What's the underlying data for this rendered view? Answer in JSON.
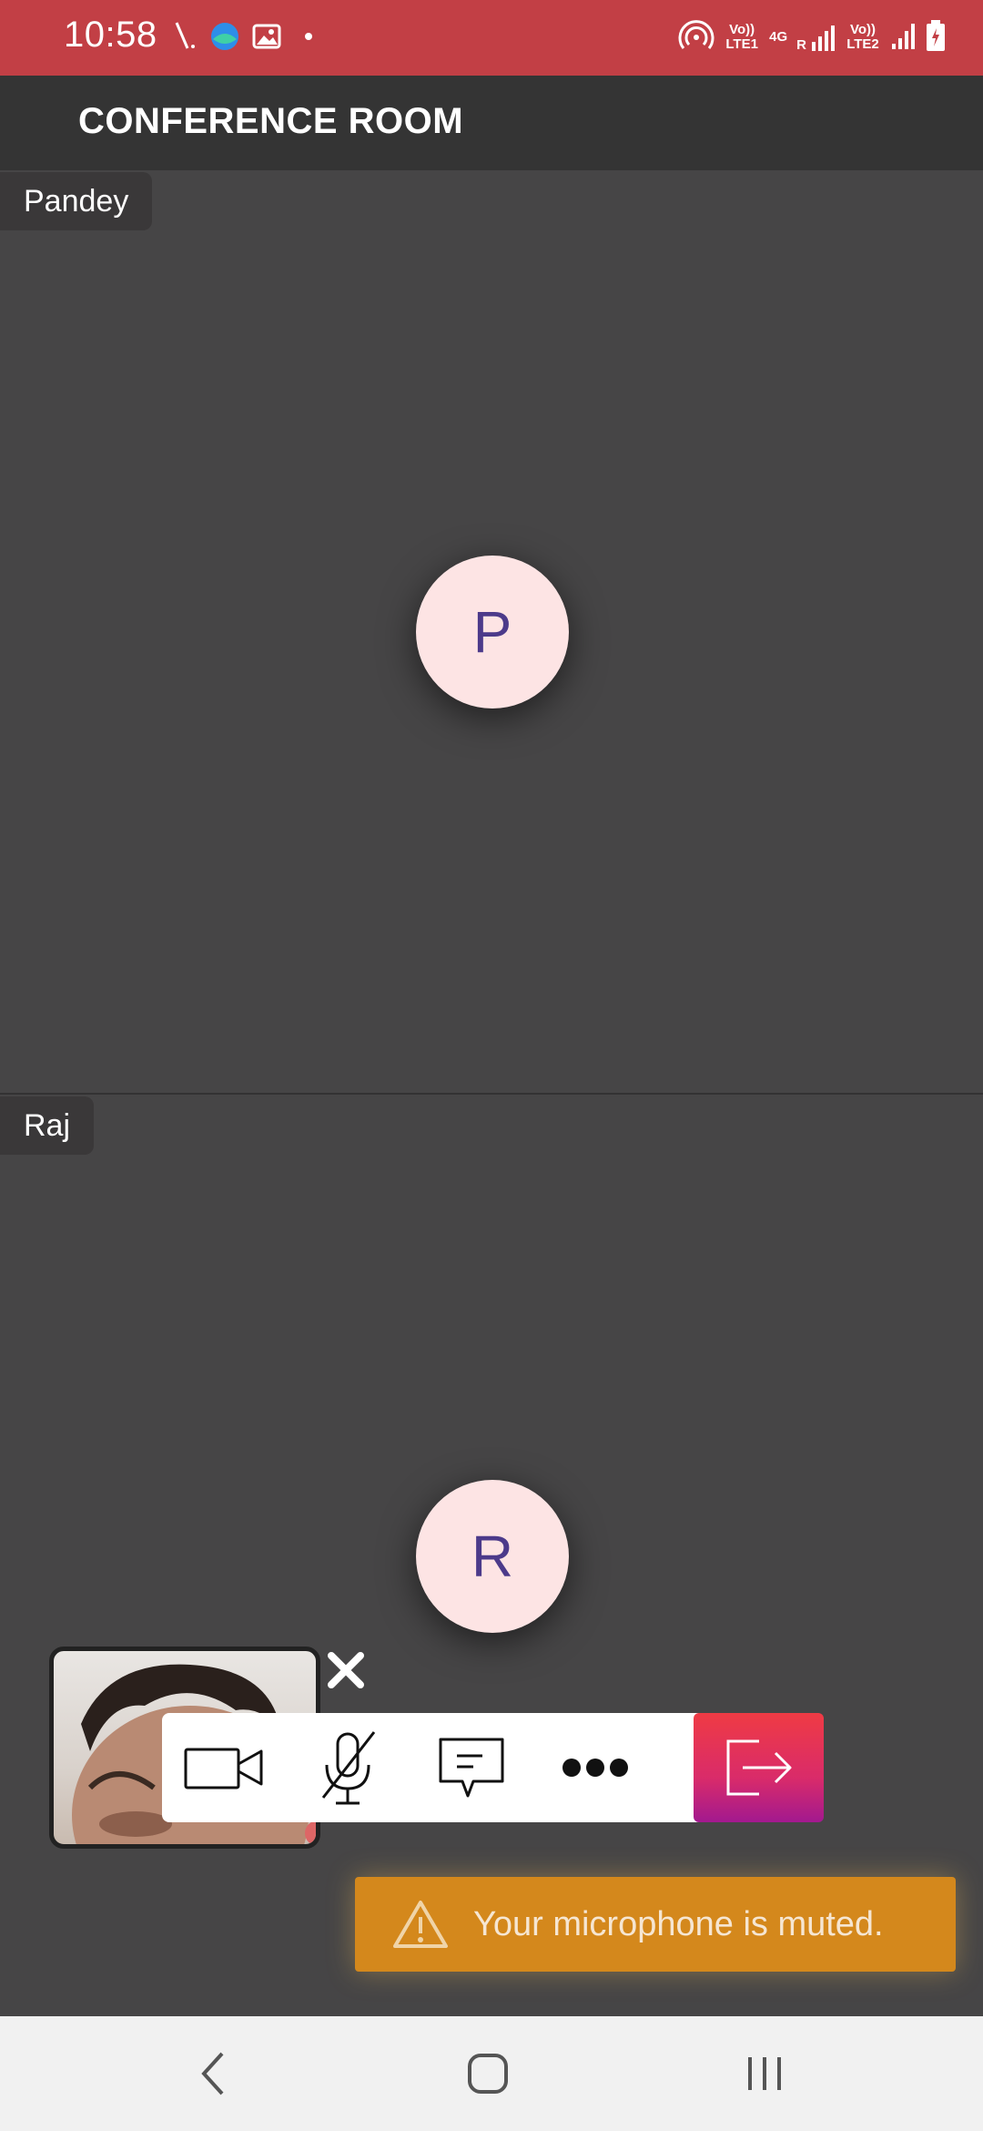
{
  "status_bar": {
    "time": "10:58",
    "network_sim1": "Vo)) LTE1",
    "network_4g": "4G",
    "roaming": "R",
    "network_sim2": "Vo)) LTE2"
  },
  "header": {
    "title": "CONFERENCE ROOM"
  },
  "participants": [
    {
      "name": "Pandey",
      "initial": "P"
    },
    {
      "name": "Raj",
      "initial": "R"
    }
  ],
  "toast": {
    "message": "Your microphone is muted."
  },
  "colors": {
    "status_bar": "#c23f45",
    "header": "#343434",
    "tile": "#464546",
    "avatar_bg": "#fde4e4",
    "avatar_text": "#4c3a8a",
    "toast_bg": "#d4881c",
    "leave_gradient_top": "#ef3b44",
    "leave_gradient_bottom": "#a2198f"
  },
  "icons": {
    "controls": [
      "video-camera-icon",
      "mic-muted-icon",
      "chat-icon",
      "more-icon",
      "leave-icon"
    ],
    "nav": [
      "back-icon",
      "home-icon",
      "recents-icon"
    ],
    "toast": "warning-icon"
  }
}
